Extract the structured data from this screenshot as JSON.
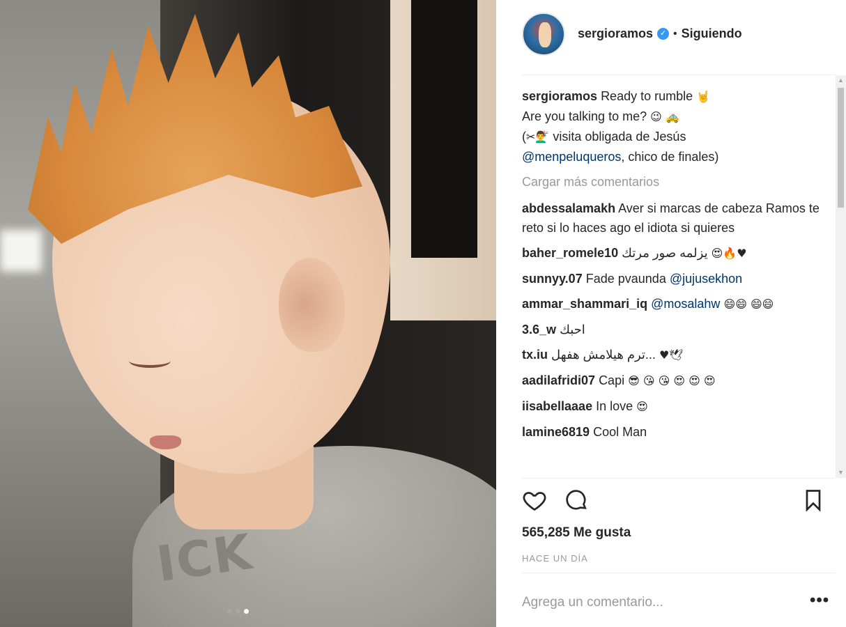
{
  "post": {
    "username": "sergioramos",
    "verified_mark": "✓",
    "separator": "•",
    "follow_state": "Siguiendo",
    "caption": {
      "user": "sergioramos",
      "line1": "Ready to rumble ",
      "line1_emoji": "🤘",
      "line2": "Are you talking to me? ",
      "line2_emoji": "😉 🚕",
      "line3_open": "(",
      "line3_emoji": "✂💇‍♂",
      "line3_text": " visita obligada de Jesús",
      "mention": "@menpeluqueros",
      "line4_text": ", chico de finales)"
    },
    "load_more": "Cargar más comentarios",
    "comments": [
      {
        "user": "abdessalamakh",
        "text": "Aver si marcas de cabeza Ramos te reto si lo haces ago el idiota si quieres"
      },
      {
        "user": "baher_romele10",
        "text": "يزلمه صور مرتك",
        "emoji": "😍🔥♥"
      },
      {
        "user": "sunnyy.07",
        "text": "Fade pvaunda ",
        "mention": "@jujusekhon"
      },
      {
        "user": "ammar_shammari_iq",
        "text": "",
        "mention": "@mosalahw",
        "emoji": " 😄😄 😄😄"
      },
      {
        "user": "3.6_w",
        "text": "احبك"
      },
      {
        "user": "tx.iu",
        "text": "ترم هيلامش هفهل...",
        "emoji": "♥🕊"
      },
      {
        "user": "aadilafridi07",
        "text": "Capi ",
        "emoji": "😎 😘 😘 😍 😍 😍"
      },
      {
        "user": "iisabellaaae",
        "text": "In love ",
        "emoji": "😍"
      },
      {
        "user": "lamine6819",
        "text": "Cool Man"
      }
    ],
    "likes_text": "565,285 Me gusta",
    "timestamp": "HACE UN DÍA",
    "add_comment_placeholder": "Agrega un comentario...",
    "more_options": "•••"
  },
  "carousel": {
    "count": 3,
    "active_index": 2
  },
  "icons": [
    "verified-icon",
    "heart-icon",
    "comment-icon",
    "bookmark-icon",
    "more-options-icon"
  ],
  "colors": {
    "verified": "#3897f0",
    "mention": "#003569",
    "muted": "#999999",
    "text": "#262626"
  }
}
